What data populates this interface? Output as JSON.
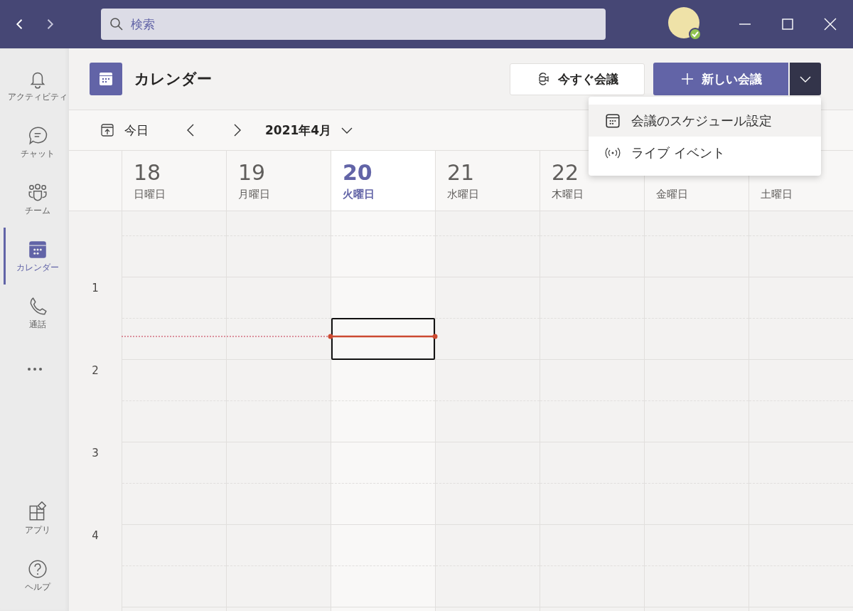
{
  "search": {
    "placeholder": "検索"
  },
  "sidebar": {
    "items": [
      {
        "kind": "activity",
        "label": "アクティビティ",
        "selected": false
      },
      {
        "kind": "chat",
        "label": "チャット",
        "selected": false
      },
      {
        "kind": "teams",
        "label": "チーム",
        "selected": false
      },
      {
        "kind": "calendar",
        "label": "カレンダー",
        "selected": true
      },
      {
        "kind": "calls",
        "label": "通話",
        "selected": false
      }
    ],
    "bottom_items": [
      {
        "kind": "apps",
        "label": "アプリ",
        "selected": false
      },
      {
        "kind": "help",
        "label": "ヘルプ",
        "selected": false
      }
    ]
  },
  "header": {
    "title": "カレンダー",
    "meet_now": "今すぐ会議",
    "new_meeting": "新しい会議"
  },
  "toolbar": {
    "today": "今日",
    "month": "2021年4月"
  },
  "days": [
    {
      "date": "18",
      "weekday": "日曜日",
      "selected": false
    },
    {
      "date": "19",
      "weekday": "月曜日",
      "selected": false
    },
    {
      "date": "20",
      "weekday": "火曜日",
      "selected": true
    },
    {
      "date": "21",
      "weekday": "水曜日",
      "selected": false
    },
    {
      "date": "22",
      "weekday": "木曜日",
      "selected": false
    },
    {
      "weekday": "金曜日",
      "selected": false
    },
    {
      "weekday": "土曜日",
      "selected": false
    }
  ],
  "hours": [
    "1",
    "2",
    "3",
    "4"
  ],
  "menu": {
    "items": [
      {
        "kind": "schedule",
        "label": "会議のスケジュール設定",
        "selected": true
      },
      {
        "kind": "live",
        "label": "ライブ イベント",
        "selected": false
      }
    ]
  }
}
